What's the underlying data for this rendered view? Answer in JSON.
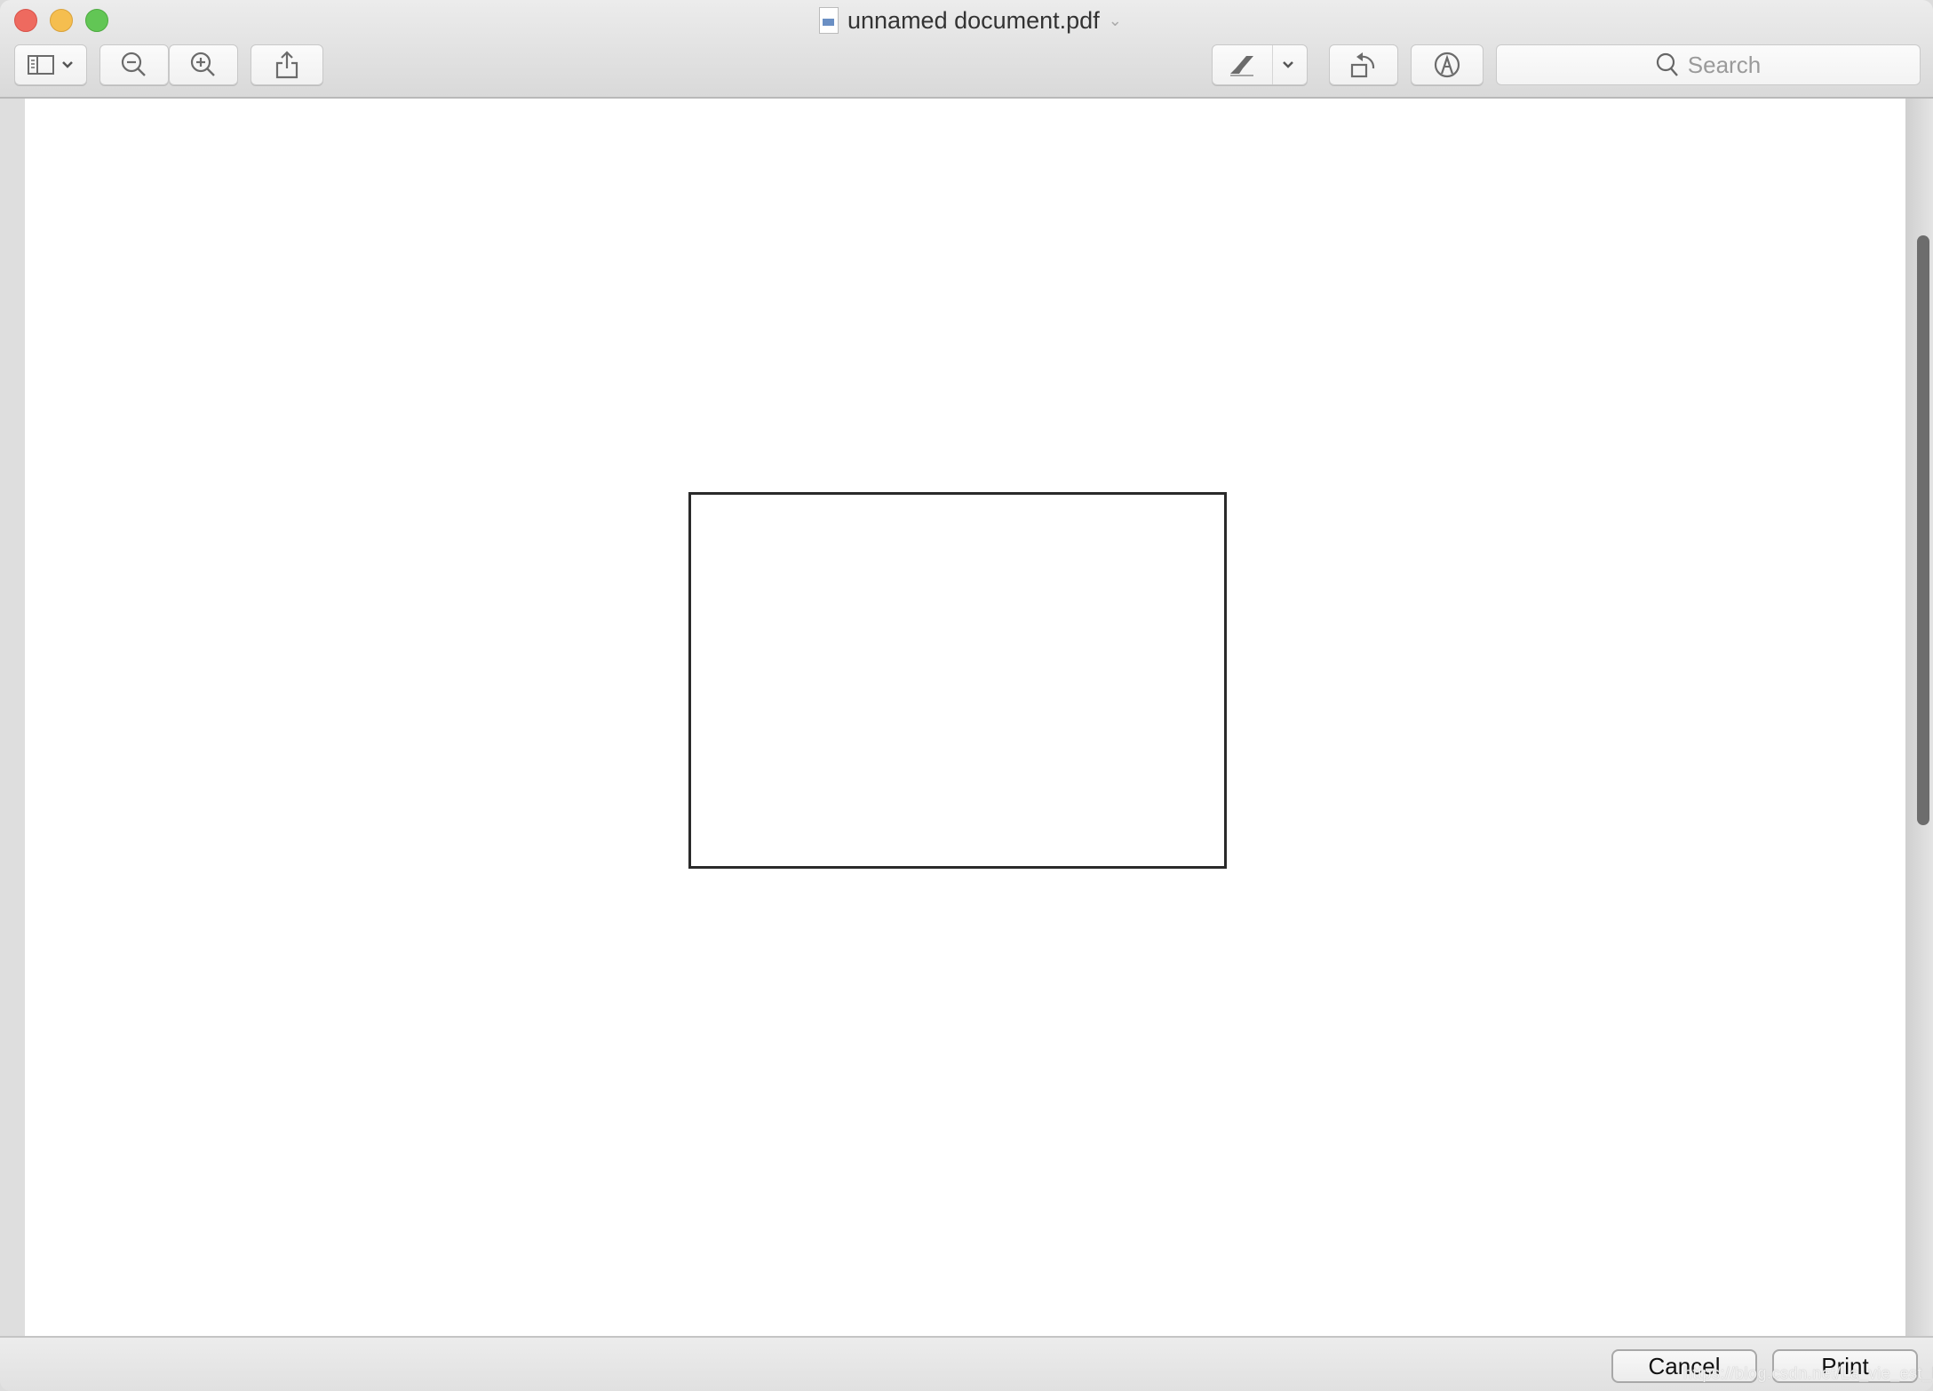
{
  "window": {
    "title": "unnamed document.pdf",
    "title_menu_icon": "chevron-down-icon",
    "traffic_lights": [
      "close",
      "minimize",
      "zoom"
    ]
  },
  "toolbar": {
    "left_buttons": [
      {
        "name": "sidebar-toggle",
        "icon": "sidebar-icon",
        "has_dropdown": true
      },
      {
        "name": "zoom-out",
        "icon": "zoom-out-icon"
      },
      {
        "name": "zoom-in",
        "icon": "zoom-in-icon"
      },
      {
        "name": "share",
        "icon": "share-icon"
      }
    ],
    "right_buttons": [
      {
        "name": "highlight",
        "icon": "highlighter-icon",
        "has_dropdown": true
      },
      {
        "name": "rotate",
        "icon": "rotate-left-icon"
      },
      {
        "name": "markup",
        "icon": "markup-pen-icon"
      }
    ],
    "search": {
      "placeholder": "Search",
      "icon": "search-icon"
    }
  },
  "document": {
    "page_content": "rectangle outline",
    "stroke_color": "#2a2a2a"
  },
  "footer": {
    "cancel_label": "Cancel",
    "print_label": "Print",
    "watermark": "https://blog.csdn.net/La_vie_est_belle"
  }
}
